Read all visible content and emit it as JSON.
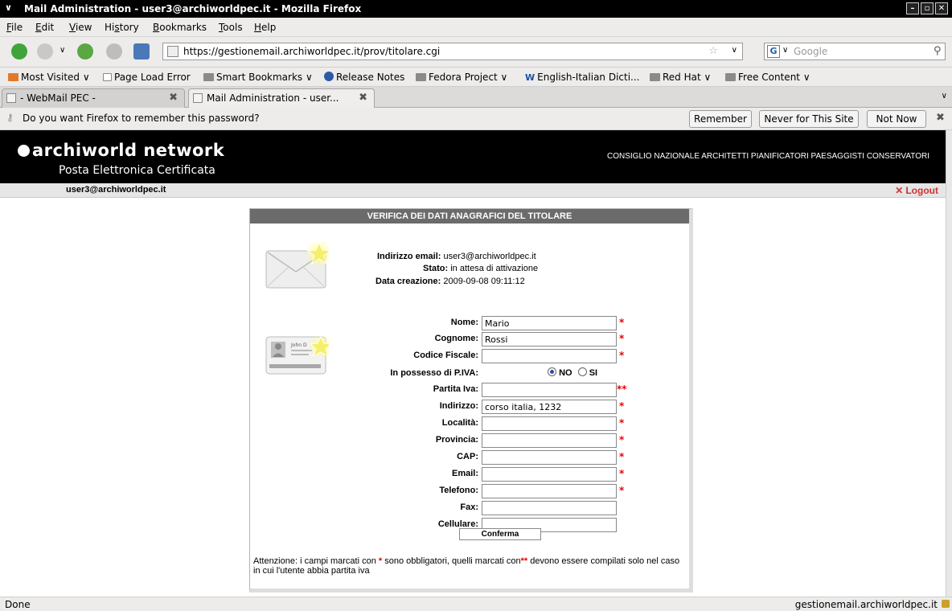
{
  "window": {
    "title": "Mail Administration - user3@archiworldpec.it - Mozilla Firefox",
    "menu_glyph": "∨"
  },
  "menubar": {
    "items": [
      "File",
      "Edit",
      "View",
      "History",
      "Bookmarks",
      "Tools",
      "Help"
    ],
    "underline": [
      "F",
      "E",
      "V",
      "s",
      "B",
      "T",
      "H"
    ]
  },
  "navbar": {
    "url": "https://gestionemail.archiworldpec.it/prov/titolare.cgi",
    "search_placeholder": "Google",
    "search_engine_glyph": "G"
  },
  "bookmarks": {
    "items": [
      {
        "label": "Most Visited ∨",
        "icon": "feed-icon"
      },
      {
        "label": "Page Load Error",
        "icon": "page-icon"
      },
      {
        "label": "Smart Bookmarks ∨",
        "icon": "folder-icon"
      },
      {
        "label": "Release Notes",
        "icon": "fedora-icon"
      },
      {
        "label": "Fedora Project ∨",
        "icon": "folder-icon"
      },
      {
        "label": "English-Italian Dicti...",
        "icon": "wordreference-icon"
      },
      {
        "label": "Red Hat ∨",
        "icon": "folder-icon"
      },
      {
        "label": "Free Content ∨",
        "icon": "folder-icon"
      }
    ]
  },
  "tabs": [
    {
      "label": "- WebMail PEC -",
      "active": false
    },
    {
      "label": "Mail Administration - user...",
      "active": true
    }
  ],
  "password_bar": {
    "message": "Do you want Firefox to remember this password?",
    "remember": "Remember",
    "never": "Never for This Site",
    "not_now": "Not Now"
  },
  "site": {
    "logo_text": "archiworld network",
    "logo_sub": "Posta Elettronica Certificata",
    "consiglio": "CONSIGLIO NAZIONALE ARCHITETTI PIANIFICATORI PAESAGGISTI CONSERVATORI",
    "user": "user3@archiworldpec.it",
    "logout": "Logout"
  },
  "panel": {
    "title": "VERIFICA DEI DATI ANAGRAFICI DEL TITOLARE",
    "email_label": "Indirizzo email:",
    "email_value": "user3@archiworldpec.it",
    "stato_label": "Stato:",
    "stato_value": "in attesa di attivazione",
    "data_label": "Data creazione:",
    "data_value": "2009-09-08 09:11:12",
    "card_name": "John D",
    "fields": [
      {
        "label": "Nome:",
        "value": "Mario",
        "req": "*"
      },
      {
        "label": "Cognome:",
        "value": "Rossi",
        "req": "*"
      },
      {
        "label": "Codice Fiscale:",
        "value": "",
        "req": "*"
      },
      {
        "label": "In possesso di P.IVA:",
        "radio": true,
        "req": ""
      },
      {
        "label": "Partita Iva:",
        "value": "",
        "req": "**"
      },
      {
        "label": "Indirizzo:",
        "value": "corso italia, 1232",
        "req": "*"
      },
      {
        "label": "Località:",
        "value": "",
        "req": "*"
      },
      {
        "label": "Provincia:",
        "value": "",
        "req": "*"
      },
      {
        "label": "CAP:",
        "value": "",
        "req": "*"
      },
      {
        "label": "Email:",
        "value": "",
        "req": "*"
      },
      {
        "label": "Telefono:",
        "value": "",
        "req": "*"
      },
      {
        "label": "Fax:",
        "value": "",
        "req": ""
      },
      {
        "label": "Cellulare:",
        "value": "",
        "req": ""
      }
    ],
    "piva_no": "NO",
    "piva_si": "SI",
    "submit": "Conferma",
    "note_a": "Attenzione: i campi marcati con",
    "note_star": "*",
    "note_b": "sono obbligatori, quelli marcati con",
    "note_stars": "**",
    "note_c": "devono essere compilati solo nel caso in cui l'utente abbia partita iva"
  },
  "status": {
    "text": "Done",
    "host": "gestionemail.archiworldpec.it"
  }
}
